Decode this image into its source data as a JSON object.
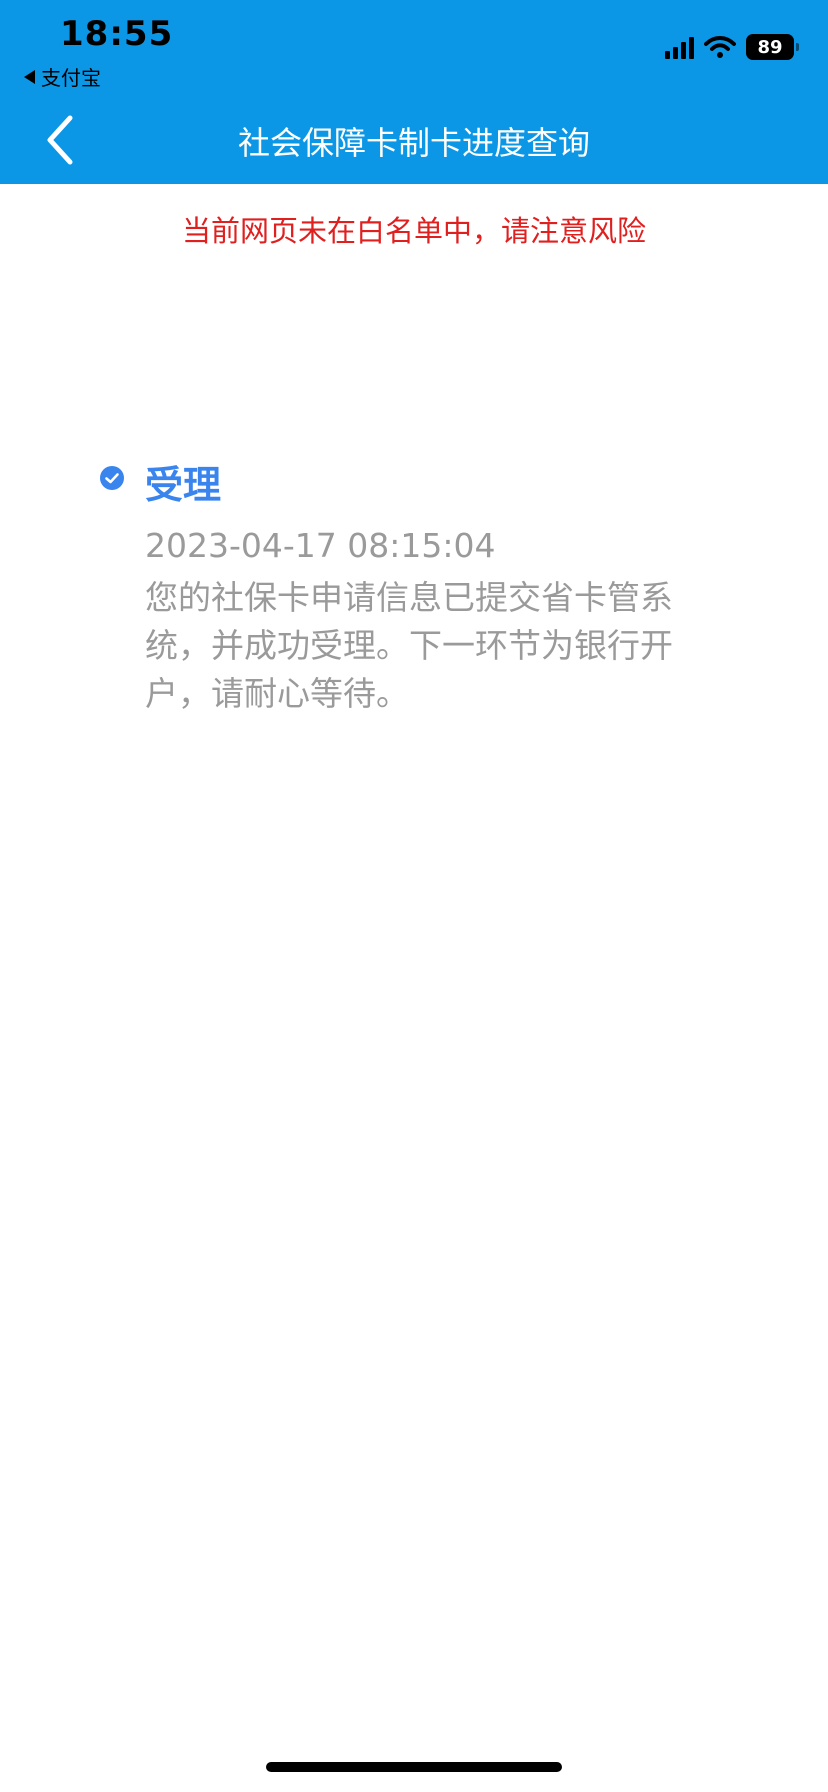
{
  "status_bar": {
    "time": "18:55",
    "back_app_label": "支付宝",
    "battery_level": "89"
  },
  "header": {
    "title": "社会保障卡制卡进度查询"
  },
  "warning": {
    "text": "当前网页未在白名单中，请注意风险"
  },
  "timeline": {
    "steps": [
      {
        "title": "受理",
        "time": "2023-04-17 08:15:04",
        "description": "您的社保卡申请信息已提交省卡管系统，并成功受理。下一环节为银行开户，请耐心等待。",
        "completed": true
      }
    ]
  },
  "colors": {
    "header_bg": "#0b97e6",
    "warning": "#e01f1f",
    "accent": "#3a84ee",
    "muted_text": "#9a9a9a"
  },
  "icons": {
    "back": "chevron-left-icon",
    "step_status": "check-circle-icon",
    "wifi": "wifi-icon",
    "signal": "signal-icon",
    "battery": "battery-icon"
  }
}
